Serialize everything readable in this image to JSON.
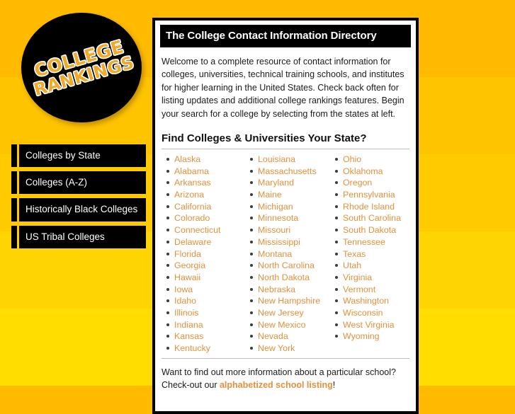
{
  "logo": {
    "line1": "COLLEGE",
    "line2": "RANKINGS",
    "disc_color": "#000000",
    "text_color": "#f0a92a",
    "outline_color": "#ffffff"
  },
  "theme": {
    "background_top": "#ffbb00",
    "background_bottom": "#ffdd00",
    "link_color": "#e2913c",
    "panel_border": "#000000",
    "panel_background": "#ffffff",
    "nav_background": "#000000",
    "nav_text": "#ffffff"
  },
  "sidebar": {
    "items": [
      {
        "label": "Colleges by State"
      },
      {
        "label": "Colleges (A-Z)"
      },
      {
        "label": "Historically Black Colleges"
      },
      {
        "label": "US Tribal Colleges"
      }
    ]
  },
  "content": {
    "title": "The College Contact Information Directory",
    "intro": "Welcome to a complete resource of contact information for colleges, universities, technical training schools, and institutes for higher learning in the United States. Check back often for listing updates and additional college rankings features. Begin your search for a college by selecting from the states at left.",
    "section_heading": "Find Colleges & Universities Your State?",
    "state_columns": [
      [
        "Alaska",
        "Alabama",
        "Arkansas",
        "Arizona",
        "California",
        "Colorado",
        "Connecticut",
        "Delaware",
        "Florida",
        "Georgia",
        "Hawaii",
        "Iowa",
        "Idaho",
        "Illinois",
        "Indiana",
        "Kansas",
        "Kentucky"
      ],
      [
        "Louisiana",
        "Massachusetts",
        "Maryland",
        "Maine",
        "Michigan",
        "Minnesota",
        "Missouri",
        "Mississippi",
        "Montana",
        "North Carolina",
        "North Dakota",
        "Nebraska",
        "New Hampshire",
        "New Jersey",
        "New Mexico",
        "Nevada",
        "New York"
      ],
      [
        "Ohio",
        "Oklahoma",
        "Oregon",
        "Pennsylvania",
        "Rhode Island",
        "South Carolina",
        "South Dakota",
        "Tennessee",
        "Texas",
        "Utah",
        "Virginia",
        "Vermont",
        "Washington",
        "Wisconsin",
        "West Virginia",
        "Wyoming"
      ]
    ],
    "footnote": {
      "prefix": "Want to find out more information about a particular school? Check-out our ",
      "link": "alphabetized school listing",
      "suffix": "!"
    }
  }
}
